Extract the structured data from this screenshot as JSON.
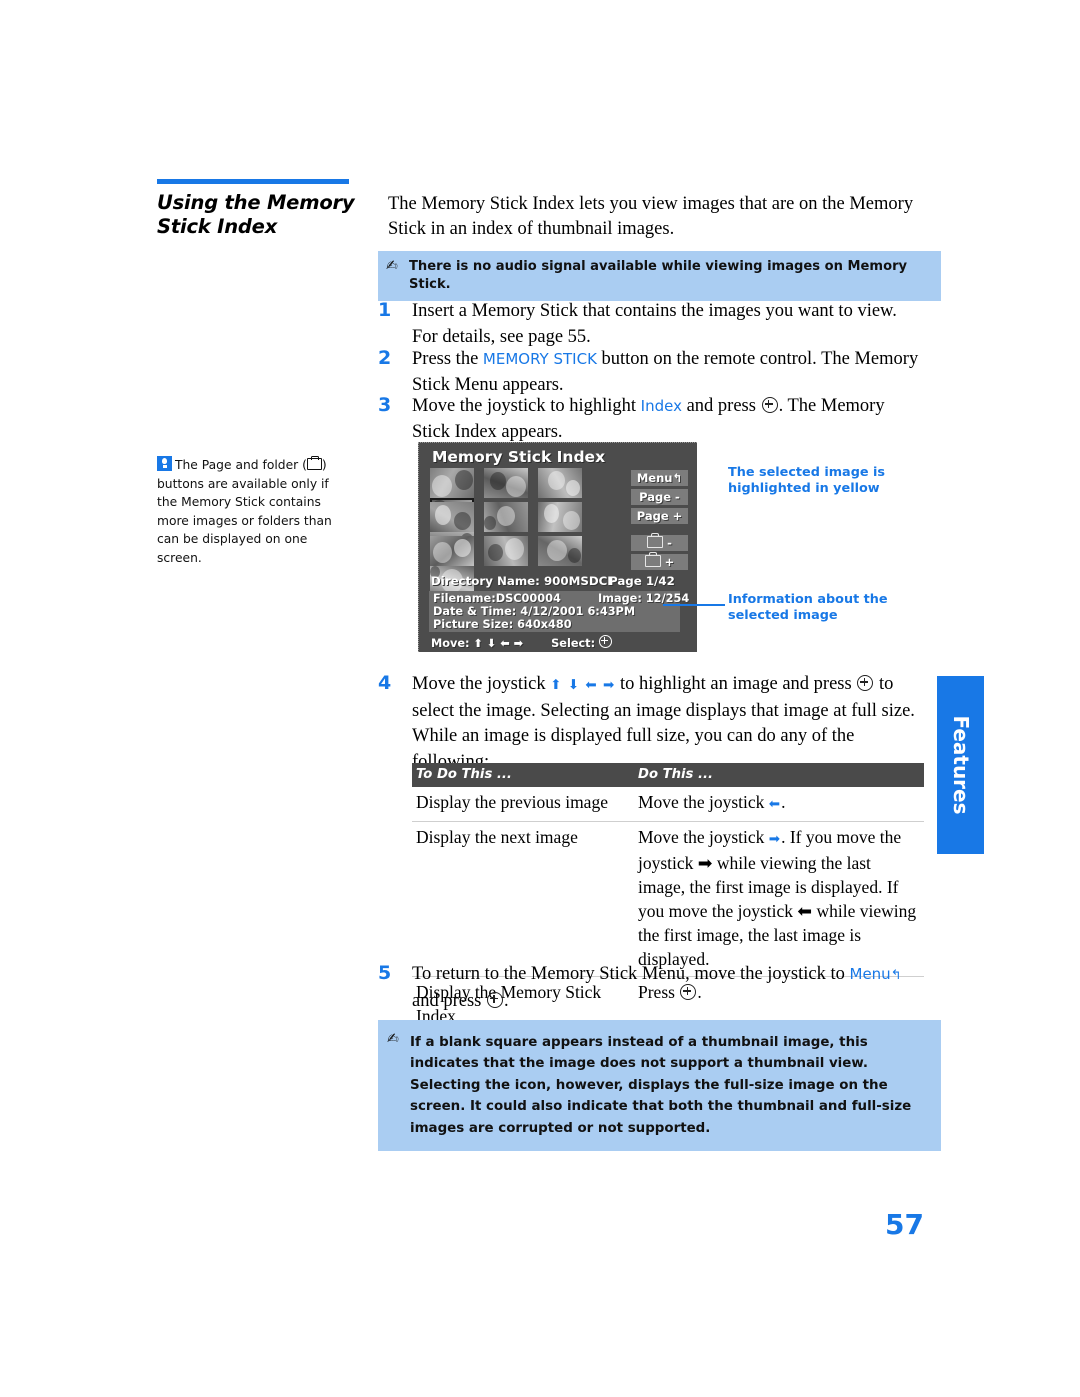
{
  "section": {
    "title": "Using the Memory Stick Index",
    "accent_color": "#1878e6"
  },
  "intro": "The Memory Stick Index lets you view images that are on the Memory Stick in an index of thumbnail images.",
  "callouts": {
    "audio": "There is no audio signal available while viewing images on Memory Stick.",
    "blank_square": "If a blank square appears instead of a thumbnail image, this indicates that the image does not support a thumbnail view. Selecting the icon, however, displays the full-size image on the screen. It could also indicate that both the thumbnail and full-size images are corrupted or not supported.",
    "icon": "pen-note-icon",
    "background_color": "#aacdf2"
  },
  "tip": {
    "icon": "lightbulb-icon",
    "text_before_folder": "The Page and folder (",
    "text_after_folder": ") buttons are available only if the Memory Stick contains more images or folders than can be displayed on one screen."
  },
  "steps": [
    {
      "num": "1",
      "text": "Insert a Memory Stick that contains the images you want to view. For details, see page 55."
    },
    {
      "num": "2",
      "pre": "Press the ",
      "ui": "MEMORY STICK",
      "post": " button on the remote control. The Memory Stick Menu appears."
    },
    {
      "num": "3",
      "pre": "Move the joystick to highlight ",
      "ui": "Index",
      "mid": " and press ",
      "post": ". The Memory Stick Index appears."
    },
    {
      "num": "4",
      "pre": "Move the joystick ",
      "joystick": "⬆ ⬇ ⬅ ➡",
      "mid": " to highlight an image and press ",
      "post": " to select the image. Selecting an image displays that image at full size. While an image is displayed full size, you can do any of the following:"
    },
    {
      "num": "5",
      "pre": "To return to the Memory Stick Menu, move the joystick to ",
      "ui": "Menu",
      "arrow": "↰",
      "mid": " and press ",
      "post": "."
    }
  ],
  "screen": {
    "title": "Memory Stick Index",
    "buttons": {
      "menu": "Menu",
      "menu_arrow": "↰",
      "page_minus": "Page -",
      "page_plus": "Page +",
      "folder_minus": "-",
      "folder_plus": "+"
    },
    "directory_label": "Directory Name: 900MSDCF",
    "page_label": "Page 1/42",
    "info": {
      "filename": "Filename:DSC00004",
      "image_count": "Image: 12/254",
      "datetime": "Date & Time: 4/12/2001 6:43PM",
      "picture_size": "Picture Size: 640x480"
    },
    "move_label": "Move:",
    "move_arrows": "⬆ ⬇ ⬅ ➡",
    "select_label": "Select:",
    "selected_thumbnail_index": 3,
    "thumbnail_rows": 3,
    "thumbnail_cols": 4
  },
  "annotations": {
    "selected_highlight": "The selected image is highlighted in yellow",
    "selected_info": "Information about the selected image",
    "color": "#1878e6"
  },
  "table": {
    "headers": [
      "To Do This ...",
      "Do This ..."
    ],
    "rows": [
      {
        "action": "Display the previous image",
        "result_pre": "Move the joystick ",
        "result_arrow": "⬅",
        "result_post": "."
      },
      {
        "action": "Display the next image",
        "result_pre": "Move the joystick ",
        "result_arrow": "➡",
        "result_post": ". If you move the joystick ➡ while viewing the last image, the first image is displayed. If you move the joystick ⬅ while viewing the first image, the last image is displayed."
      },
      {
        "action": "Display the Memory Stick Index",
        "result_pre": "Press ",
        "result_arrow": "",
        "result_post": "."
      }
    ]
  },
  "tab": {
    "label": "Features",
    "color": "#1878e6"
  },
  "page_number": "57"
}
